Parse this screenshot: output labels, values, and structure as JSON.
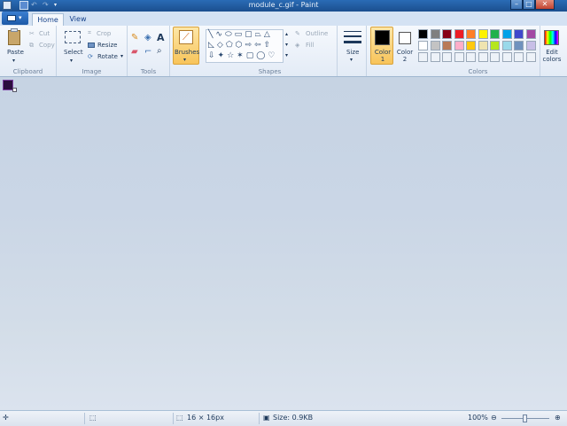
{
  "window": {
    "title": "module_c.gif - Paint"
  },
  "tabs": [
    {
      "label": "Home"
    },
    {
      "label": "View"
    }
  ],
  "clipboard": {
    "paste": "Paste",
    "cut": "Cut",
    "copy": "Copy",
    "group": "Clipboard"
  },
  "image": {
    "select": "Select",
    "crop": "Crop",
    "resize": "Resize",
    "rotate": "Rotate",
    "group": "Image"
  },
  "tools": {
    "group": "Tools"
  },
  "brushes": {
    "label": "Brushes"
  },
  "shapes": {
    "outline": "Outline",
    "fill": "Fill",
    "group": "Shapes"
  },
  "size": {
    "label": "Size"
  },
  "color1": {
    "label": "Color 1",
    "value": "#000000"
  },
  "color2": {
    "label": "Color 2",
    "value": "#ffffff"
  },
  "colors": {
    "group": "Colors",
    "edit": "Edit colors",
    "row1": [
      "#000000",
      "#7f7f7f",
      "#880015",
      "#ed1c24",
      "#ff7f27",
      "#fff200",
      "#22b14c",
      "#00a2e8",
      "#3f48cc",
      "#a349a4"
    ],
    "row2": [
      "#ffffff",
      "#c3c3c3",
      "#b97a57",
      "#ffaec9",
      "#ffc90e",
      "#efe4b0",
      "#b5e61d",
      "#99d9ea",
      "#7092be",
      "#c8bfe7"
    ]
  },
  "status": {
    "dimensions": "16 × 16px",
    "size": "Size: 0.9KB",
    "zoom": "100%",
    "zoom_level": 100
  }
}
